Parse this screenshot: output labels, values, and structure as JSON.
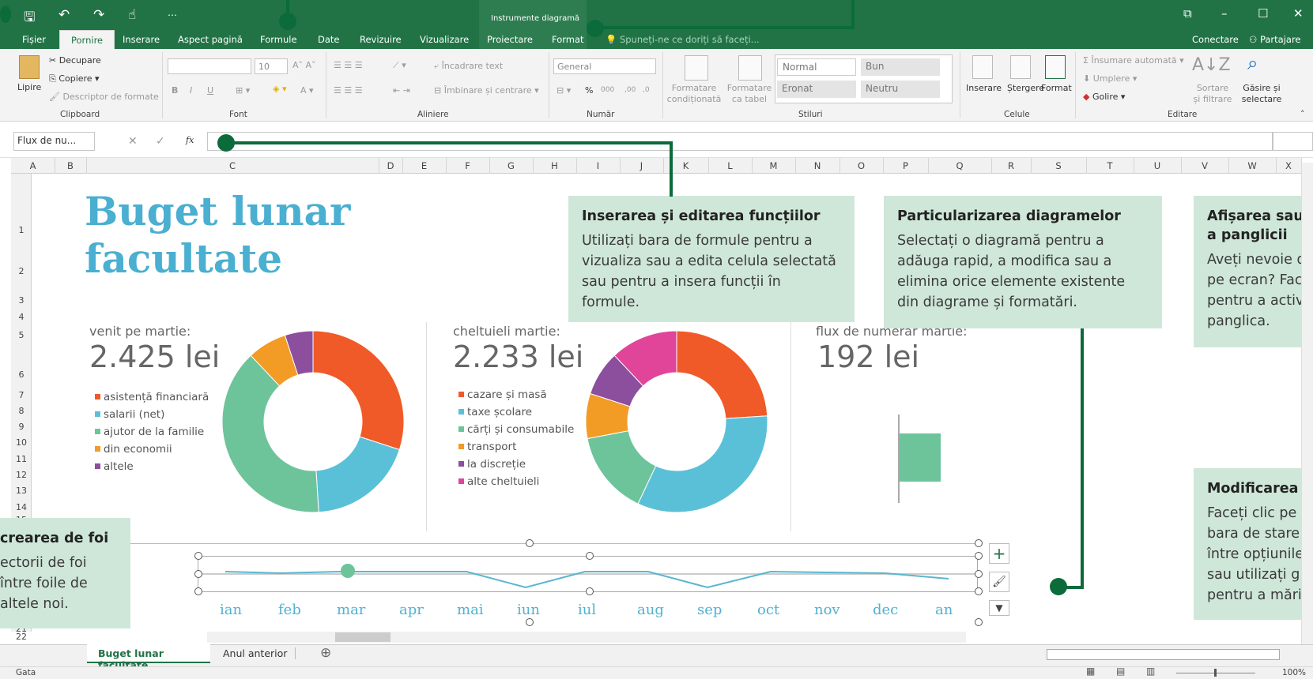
{
  "qat": {
    "save": "🖫",
    "undo": "↶",
    "redo": "↷",
    "touch": "☝",
    "more": "⋯"
  },
  "title": {
    "context_label": "Instrumente diagramă"
  },
  "window": {
    "ribbon_opts": "⧉",
    "minimize": "–",
    "maximize": "☐",
    "close": "✕"
  },
  "tabs": [
    "Fișier",
    "Pornire",
    "Inserare",
    "Aspect pagină",
    "Formule",
    "Date",
    "Revizuire",
    "Vizualizare",
    "Proiectare",
    "Format"
  ],
  "tell_me": "Spuneți-ne ce doriți să faceți...",
  "account": {
    "signin": "Conectare",
    "share": "Partajare"
  },
  "ribbon": {
    "clipboard": {
      "paste": "Lipire",
      "cut": "Decupare",
      "copy": "Copiere",
      "painter": "Descriptor de formate",
      "label": "Clipboard"
    },
    "font": {
      "size": "10",
      "bold": "B",
      "italic": "I",
      "underline": "U",
      "label": "Font"
    },
    "align": {
      "wrap": "Încadrare text",
      "merge": "Îmbinare și centrare",
      "label": "Aliniere"
    },
    "number": {
      "format": "General",
      "percent": "%",
      "thousands": "000",
      "inc": ",00",
      "dec": ",0",
      "label": "Număr"
    },
    "styles": {
      "cond": "Formatare condiționată",
      "table": "Formatare ca tabel",
      "normal": "Normal",
      "good": "Bun",
      "bad": "Eronat",
      "neutral": "Neutru",
      "label": "Stiluri"
    },
    "cells": {
      "insert": "Inserare",
      "delete": "Ștergere",
      "format": "Format",
      "label": "Celule"
    },
    "edit": {
      "autosum": "Însumare automată",
      "fill": "Umplere",
      "clear": "Golire",
      "sort": "Sortare și filtrare",
      "find": "Găsire și selectare",
      "label": "Editare"
    }
  },
  "formula_bar": {
    "name_box": "Flux de nu...",
    "fx": "fx",
    "cancel": "✕",
    "enter": "✓"
  },
  "columns": [
    "A",
    "B",
    "C",
    "D",
    "E",
    "F",
    "G",
    "H",
    "I",
    "J",
    "K",
    "L",
    "M",
    "N",
    "O",
    "P",
    "Q",
    "R",
    "S",
    "T",
    "U",
    "V",
    "W",
    "X"
  ],
  "rows": [
    "1",
    "2",
    "3",
    "4",
    "5",
    "6",
    "7",
    "8",
    "9",
    "10",
    "11",
    "12",
    "13",
    "14",
    "15",
    "21",
    "22"
  ],
  "sheet": {
    "title_line1": "Buget lunar",
    "title_line2": "facultate",
    "income": {
      "label": "venit pe martie:",
      "value": "2.425 lei",
      "legend": [
        "asistență financiară",
        "salarii (net)",
        "ajutor de la familie",
        "din economii",
        "altele"
      ]
    },
    "expenses": {
      "label": "cheltuieli martie:",
      "value": "2.233 lei",
      "legend": [
        "cazare și masă",
        "taxe școlare",
        "cărți și consumabile",
        "transport",
        "la discreție",
        "alte cheltuieli"
      ]
    },
    "cashflow": {
      "label": "flux de numerar martie:",
      "value": "192 lei"
    },
    "months": [
      "ian",
      "feb",
      "mar",
      "apr",
      "mai",
      "iun",
      "iul",
      "aug",
      "sep",
      "oct",
      "nov",
      "dec",
      "an"
    ]
  },
  "chart_data": [
    {
      "type": "pie",
      "title": "venit pe martie:",
      "categories": [
        "asistență financiară",
        "salarii (net)",
        "ajutor de la familie",
        "din economii",
        "altele"
      ],
      "values": [
        0.3,
        0.19,
        0.39,
        0.07,
        0.05
      ],
      "colors": [
        "#f05a28",
        "#5ac0d8",
        "#6dc49b",
        "#f29b25",
        "#8b4f9e"
      ]
    },
    {
      "type": "pie",
      "title": "cheltuieli martie:",
      "categories": [
        "cazare și masă",
        "taxe școlare",
        "cărți și consumabile",
        "transport",
        "la discreție",
        "alte cheltuieli"
      ],
      "values": [
        0.24,
        0.33,
        0.15,
        0.08,
        0.08,
        0.12
      ],
      "colors": [
        "#f05a28",
        "#5ac0d8",
        "#6dc49b",
        "#f29b25",
        "#8b4f9e",
        "#e0459a"
      ]
    }
  ],
  "callouts": {
    "functions": {
      "title": "Inserarea și editarea funcțiilor",
      "body": "Utilizați bara de formule pentru a vizualiza sau a edita celula selectată sau pentru a insera funcții în formule."
    },
    "charts": {
      "title": "Particularizarea diagramelor",
      "body": "Selectați o diagramă pentru a adăuga rapid, a modifica sau a elimina orice elemente existente din diagrame și formatări."
    },
    "ribbon": {
      "title": "Afișarea sau a panglicii",
      "body": "Aveți nevoie d pe ecran? Face pentru a activa panglica."
    },
    "view": {
      "title": "Modificarea v",
      "body": "Faceți clic pe b bara de stare p între opțiunile sau utilizați gli pentru a mări"
    },
    "sheets": {
      "title": "crearea de foi",
      "body": "ectorii de foi între foile de altele noi."
    }
  },
  "sheet_tabs": {
    "active": "Buget lunar facultate",
    "other": "Anul anterior",
    "add": "⊕"
  },
  "status": {
    "ready": "Gata",
    "zoom": "100%"
  },
  "colors": {
    "accent": "#217346",
    "callout": "#cfe7d9",
    "connector": "#0b6b3a",
    "title": "#4aafd0"
  }
}
